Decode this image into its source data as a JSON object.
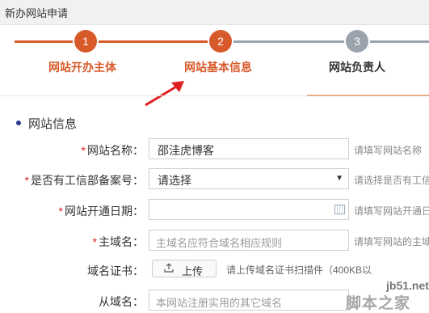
{
  "window": {
    "title": "新办网站申请"
  },
  "steps": [
    {
      "number": "1",
      "label": "网站开办主体"
    },
    {
      "number": "2",
      "label": "网站基本信息"
    },
    {
      "number": "3",
      "label": "网站负责人"
    }
  ],
  "section": {
    "title": "网站信息"
  },
  "form": {
    "site_name": {
      "label": "网站名称：",
      "value": "邵洼虎博客",
      "hint": "请填写网站名称"
    },
    "icp_filed": {
      "label": "是否有工信部备案号：",
      "selected": "请选择",
      "hint": "请选择是否有工信"
    },
    "open_date": {
      "label": "网站开通日期：",
      "value": "",
      "hint": "请填写网站开通日"
    },
    "main_domain": {
      "label": "主域名：",
      "placeholder": "主域名应符合域名相应规则",
      "hint": "请填写网站的主域"
    },
    "domain_cert": {
      "label": "域名证书：",
      "button": "上传",
      "hint": "请上传域名证书扫描件（400KB以"
    },
    "sub_domain": {
      "label": "从域名：",
      "placeholder": "本网站注册实用的其它域名"
    }
  },
  "watermark": {
    "line1": "jb51.net",
    "line2": "脚本之家"
  },
  "colors": {
    "accent": "#d85a2a",
    "inactive": "#9ba3ad",
    "required": "#e02020"
  }
}
